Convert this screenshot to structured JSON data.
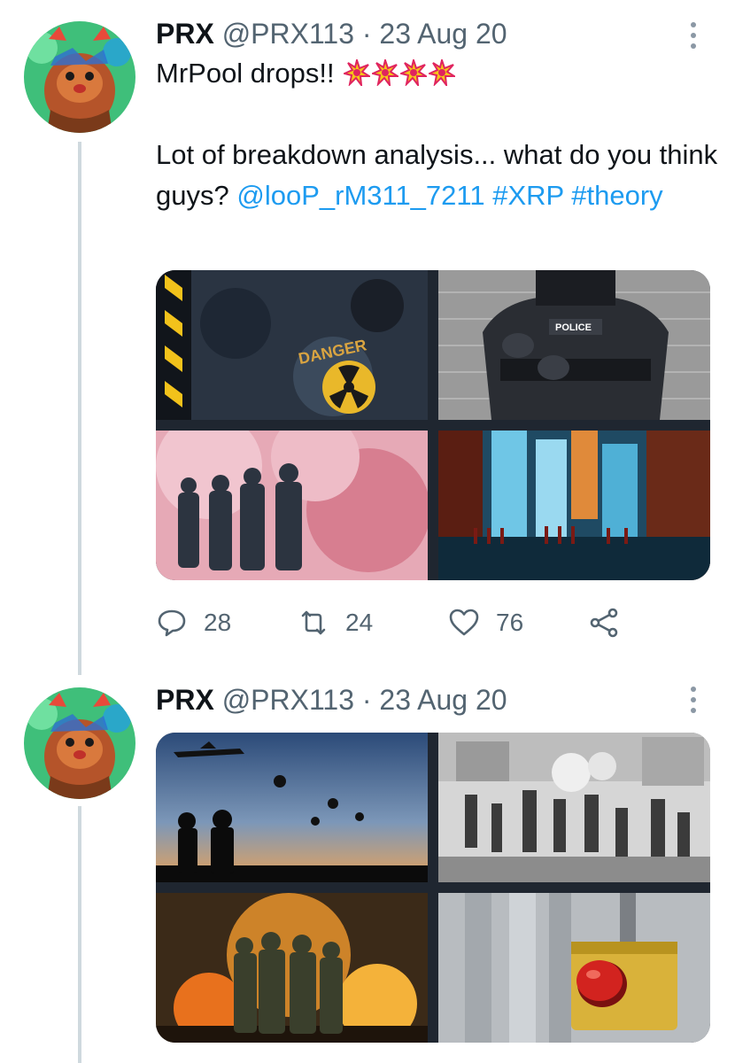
{
  "tweets": [
    {
      "author_name": "PRX",
      "handle": "@PRX113",
      "separator": "·",
      "date": "23 Aug 20",
      "text_line1": "MrPool drops!!",
      "emoji_icons": [
        "collision-icon",
        "collision-icon",
        "collision-icon",
        "collision-icon"
      ],
      "text_line2": "Lot of breakdown analysis... what do you think guys?",
      "mention": "@looP_rM311_7211",
      "hashtag1": "#XRP",
      "hashtag2": "#theory",
      "images": [
        {
          "label": "DANGER",
          "icon": "radiation-icon"
        },
        {
          "label": "POLICE",
          "icon": "armored-police-icon"
        },
        {
          "icon": "swat-team-smoke-icon"
        },
        {
          "icon": "futuristic-city-icon"
        }
      ],
      "actions": {
        "replies": "28",
        "retweets": "24",
        "likes": "76"
      }
    },
    {
      "author_name": "PRX",
      "handle": "@PRX113",
      "separator": "·",
      "date": "23 Aug 20",
      "images": [
        {
          "icon": "paratroopers-icon"
        },
        {
          "icon": "riot-engraving-icon"
        },
        {
          "icon": "soldiers-fire-icon"
        },
        {
          "icon": "red-button-icon"
        }
      ]
    }
  ],
  "colors": {
    "link": "#1d9bf0",
    "secondary_text": "#536471",
    "thread_line": "#cfd9de"
  }
}
